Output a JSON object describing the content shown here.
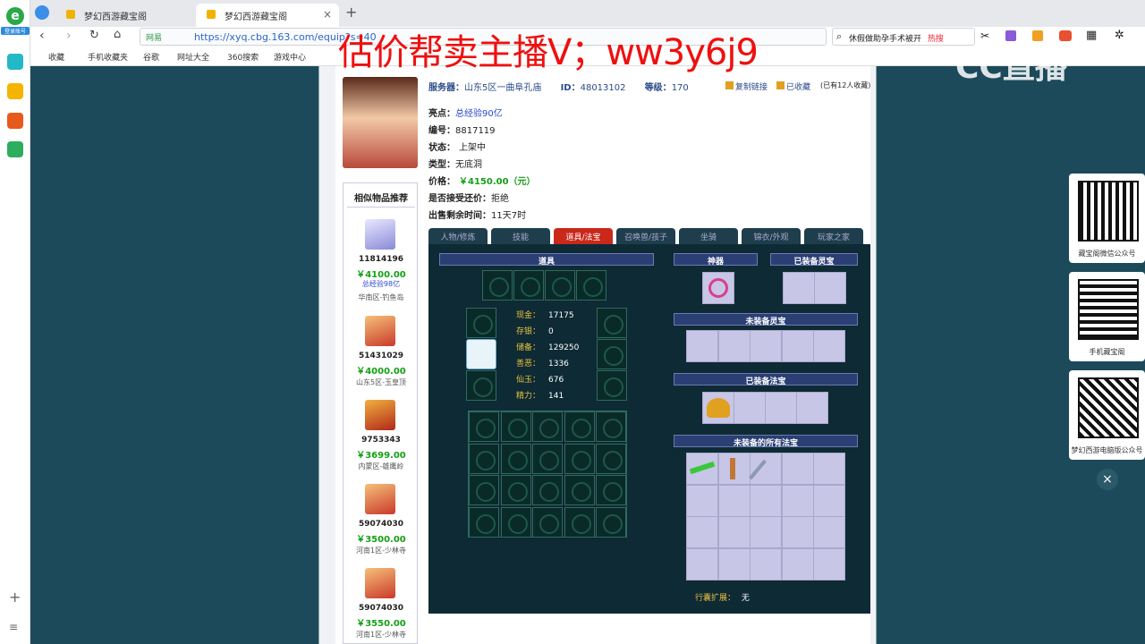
{
  "browser": {
    "tabs": [
      {
        "title": "梦幻西游藏宝阁"
      },
      {
        "title": "梦幻西游藏宝阁"
      }
    ],
    "new_tab": "+",
    "url_prefix": "网易",
    "url": "https://xyq.cbg.163.com/equip?s=40",
    "search_text": "休假做助孕手术被开",
    "hot_badge": "热搜",
    "bookmarks": [
      "收藏",
      "手机收藏夹",
      "谷歌",
      "网址大全",
      "360搜索",
      "游戏中心"
    ],
    "left_badge": "登录账号"
  },
  "overlay_text": "估价帮卖主播V；ww3y6j9",
  "cc_logo": "CC直播",
  "listing": {
    "server_label": "服务器：",
    "server": "山东5区一曲阜孔庙",
    "id_label": "ID：",
    "id": "48013102",
    "level_label": "等级：",
    "level": "170",
    "copy_link": "复制链接",
    "collected": "已收藏",
    "collect_count": "(已有12人收藏)",
    "highlights_label": "亮点：",
    "highlights": "总经验90亿",
    "number_label": "编号：",
    "number": "8817119",
    "status_label": "状态：",
    "status": "上架中",
    "type_label": "类型：",
    "type": "无底洞",
    "price_label": "价格：",
    "price": "￥4150.00（元）",
    "bargain_label": "是否接受还价：",
    "bargain": "拒绝",
    "remaining_label": "出售剩余时间：",
    "remaining": "11天7时"
  },
  "related": {
    "title": "相似物品推荐",
    "items": [
      {
        "id": "11814196",
        "price": "￥4100.00",
        "note": "总经验98亿",
        "server": "华南区-钓鱼岛"
      },
      {
        "id": "51431029",
        "price": "￥4000.00",
        "note": "",
        "server": "山东5区-玉皇顶"
      },
      {
        "id": "9753343",
        "price": "￥3699.00",
        "note": "",
        "server": "内蒙区-雄鹰岭"
      },
      {
        "id": "59074030",
        "price": "￥3500.00",
        "note": "",
        "server": "河南1区-少林寺"
      },
      {
        "id": "59074030",
        "price": "￥3550.00",
        "note": "",
        "server": "河南1区-少林寺"
      }
    ]
  },
  "detail_tabs": [
    "人物/修炼",
    "技能",
    "道具/法宝",
    "召唤兽/孩子",
    "坐骑",
    "锦衣/外观",
    "玩家之家"
  ],
  "panel": {
    "items_header": "道具",
    "artifact_header": "神器",
    "equipped_spirit_header": "已装备灵宝",
    "unequipped_spirit_header": "未装备灵宝",
    "equipped_treasure_header": "已装备法宝",
    "all_unequipped_treasure_header": "未装备的所有法宝",
    "stats": [
      {
        "key": "现金：",
        "value": "17175"
      },
      {
        "key": "存银：",
        "value": "0"
      },
      {
        "key": "储备：",
        "value": "129250"
      },
      {
        "key": "善恶：",
        "value": "1336"
      },
      {
        "key": "仙玉：",
        "value": "676"
      },
      {
        "key": "精力：",
        "value": "141"
      }
    ],
    "bag_expand_label": "行囊扩展：",
    "bag_expand_value": "无"
  },
  "qr_cards": [
    {
      "label": "藏宝阁微信公众号"
    },
    {
      "label": "手机藏宝阁"
    },
    {
      "label": "梦幻西游电脑版公众号"
    }
  ],
  "colors": {
    "accent": "#c9281b",
    "price_green": "#15a015",
    "panel_bg": "#0e2a34",
    "header_blue": "#2b3f74"
  }
}
